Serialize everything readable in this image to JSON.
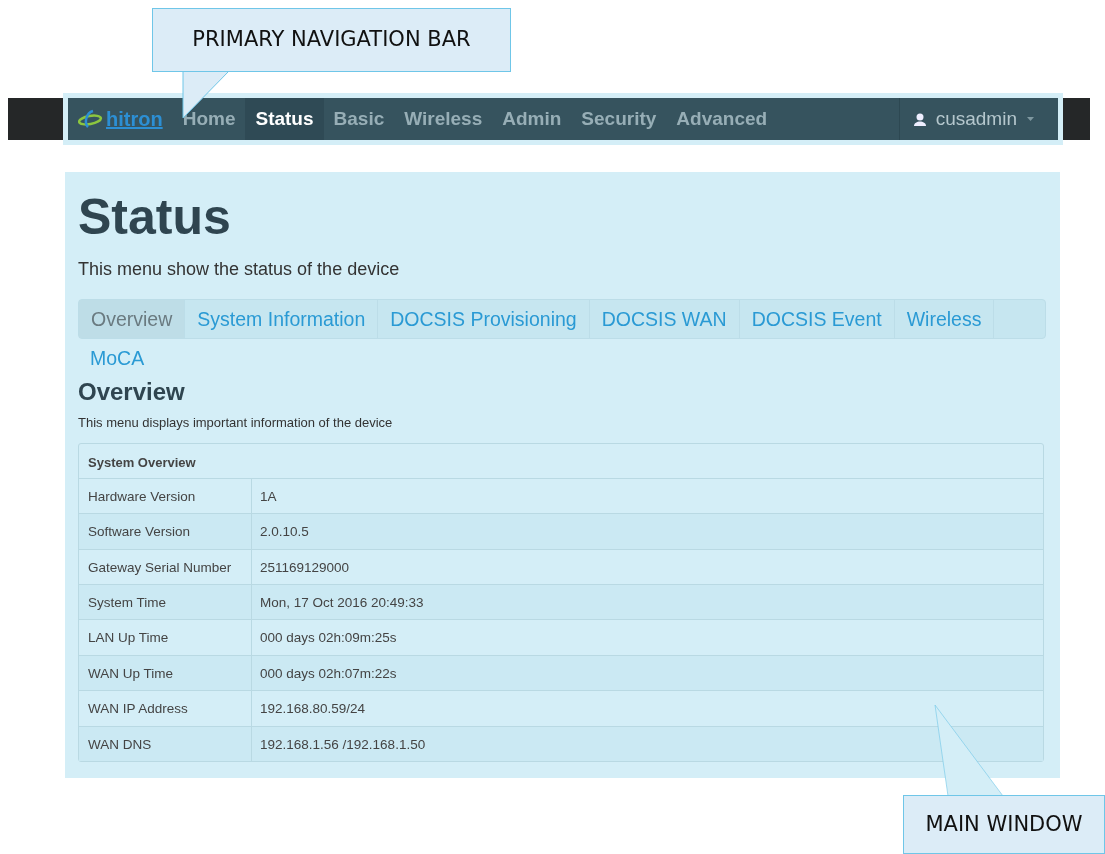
{
  "annotations": [
    {
      "text": "PRIMARY NAVIGATION BAR",
      "kind": "top"
    },
    {
      "text": "MAIN WINDOW",
      "kind": "bottom"
    }
  ],
  "navbar": {
    "brand": "hitron",
    "items": [
      {
        "label": "Home",
        "selected": false
      },
      {
        "label": "Status",
        "selected": true
      },
      {
        "label": "Basic",
        "selected": false
      },
      {
        "label": "Wireless",
        "selected": false
      },
      {
        "label": "Admin",
        "selected": false
      },
      {
        "label": "Security",
        "selected": false
      },
      {
        "label": "Advanced",
        "selected": false
      }
    ],
    "user": "cusadmin"
  },
  "page": {
    "title": "Status",
    "subtitle": "This menu show the status of the device"
  },
  "tabs": [
    {
      "label": "Overview",
      "selected": true
    },
    {
      "label": "System Information",
      "selected": false
    },
    {
      "label": "DOCSIS Provisioning",
      "selected": false
    },
    {
      "label": "DOCSIS WAN",
      "selected": false
    },
    {
      "label": "DOCSIS Event",
      "selected": false
    },
    {
      "label": "Wireless",
      "selected": false
    },
    {
      "label": "MoCA",
      "selected": false
    }
  ],
  "section": {
    "title": "Overview",
    "description": "This menu displays important information of the device"
  },
  "table": {
    "title": "System Overview",
    "rows": [
      {
        "label": "Hardware Version",
        "value": "1A"
      },
      {
        "label": "Software Version",
        "value": "2.0.10.5"
      },
      {
        "label": "Gateway Serial Number",
        "value": "251169129000"
      },
      {
        "label": "System Time",
        "value": "Mon, 17 Oct 2016 20:49:33"
      },
      {
        "label": "LAN Up Time",
        "value": "000 days 02h:09m:25s"
      },
      {
        "label": "WAN Up Time",
        "value": "000 days 02h:07m:22s"
      },
      {
        "label": "WAN IP Address",
        "value": "192.168.80.59/24"
      },
      {
        "label": "WAN DNS",
        "value": "192.168.1.56 /192.168.1.50"
      }
    ]
  }
}
